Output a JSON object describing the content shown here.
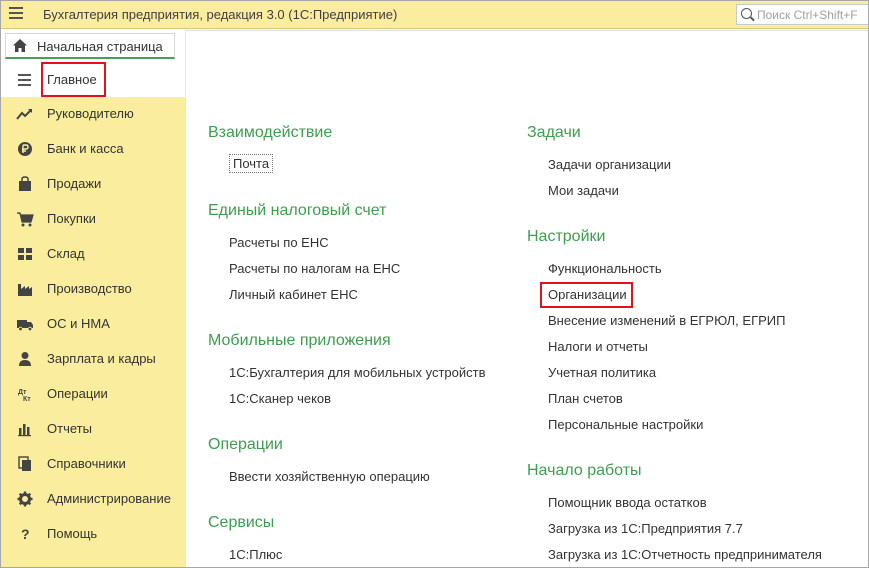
{
  "window": {
    "title": "Бухгалтерия предприятия, редакция 3.0  (1С:Предприятие)",
    "search_placeholder": "Поиск Ctrl+Shift+F"
  },
  "home_tab": {
    "label": "Начальная страница"
  },
  "sidebar": {
    "main_label": "Главное",
    "items": [
      {
        "label": "Руководителю",
        "icon": "trend-up-icon"
      },
      {
        "label": "Банк и касса",
        "icon": "ruble-coin-icon"
      },
      {
        "label": "Продажи",
        "icon": "shopping-bag-icon"
      },
      {
        "label": "Покупки",
        "icon": "shopping-cart-icon"
      },
      {
        "label": "Склад",
        "icon": "warehouse-grid-icon"
      },
      {
        "label": "Производство",
        "icon": "factory-icon"
      },
      {
        "label": "ОС и НМА",
        "icon": "truck-icon"
      },
      {
        "label": "Зарплата и кадры",
        "icon": "person-icon"
      },
      {
        "label": "Операции",
        "icon": "debit-credit-icon"
      },
      {
        "label": "Отчеты",
        "icon": "bar-chart-icon"
      },
      {
        "label": "Справочники",
        "icon": "books-icon"
      },
      {
        "label": "Администрирование",
        "icon": "gear-icon"
      },
      {
        "label": "Помощь",
        "icon": "question-icon"
      }
    ]
  },
  "groups_left": [
    {
      "title": "Взаимодействие",
      "links": [
        "Почта"
      ]
    },
    {
      "title": "Единый налоговый счет",
      "links": [
        "Расчеты по ЕНС",
        "Расчеты по налогам на ЕНС",
        "Личный кабинет ЕНС"
      ]
    },
    {
      "title": "Мобильные приложения",
      "links": [
        "1С:Бухгалтерия для мобильных устройств",
        "1С:Сканер чеков"
      ]
    },
    {
      "title": "Операции",
      "links": [
        "Ввести хозяйственную операцию"
      ]
    },
    {
      "title": "Сервисы",
      "links": [
        "1С:Плюс"
      ]
    }
  ],
  "groups_right": [
    {
      "title": "Задачи",
      "links": [
        "Задачи организации",
        "Мои задачи"
      ]
    },
    {
      "title": "Настройки",
      "links": [
        "Функциональность",
        "Организации",
        "Внесение изменений в ЕГРЮЛ, ЕГРИП",
        "Налоги и отчеты",
        "Учетная политика",
        "План счетов",
        "Персональные настройки"
      ]
    },
    {
      "title": "Начало работы",
      "links": [
        "Помощник ввода остатков",
        "Загрузка из 1С:Предприятия 7.7",
        "Загрузка из 1С:Отчетность предпринимателя"
      ]
    }
  ]
}
